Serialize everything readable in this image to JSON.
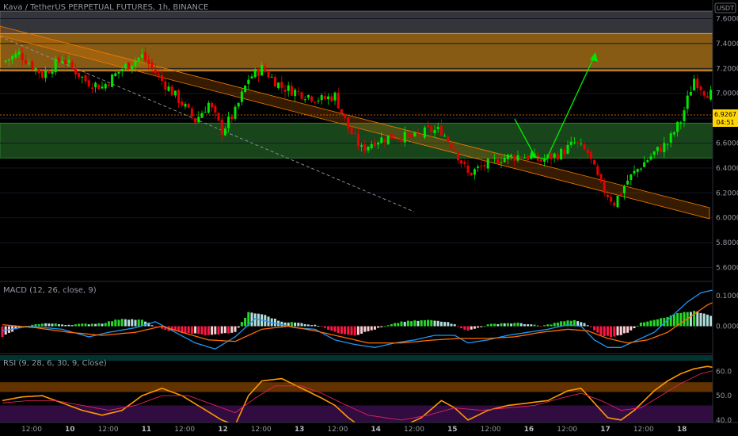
{
  "header": {
    "title": "Kava / TetherUS PERPETUAL FUTURES, 1h, BINANCE",
    "currency": "USDT"
  },
  "price_tag": {
    "price": "6.9267",
    "countdown": "04:51"
  },
  "chart_data": [
    {
      "type": "candlestick",
      "title": "Kava / TetherUS PERPETUAL FUTURES, 1h, BINANCE",
      "y_ticks": [
        "7.6000",
        "7.4000",
        "7.2000",
        "7.0000",
        "6.8000",
        "6.6000",
        "6.4000",
        "6.2000",
        "6.0000",
        "5.8000",
        "5.6000"
      ],
      "ylim": [
        5.52,
        7.75
      ],
      "x_ticks": [
        "12:00",
        "10",
        "12:00",
        "11",
        "12:00",
        "12",
        "12:00",
        "13",
        "12:00",
        "14",
        "12:00",
        "15",
        "12:00",
        "16",
        "12:00",
        "17",
        "12:00",
        "18"
      ],
      "last_price": 6.9267,
      "colors": {
        "up": "#26a69a",
        "down": "#ef5350",
        "up_bright": "#00e600",
        "down_bright": "#e60000"
      },
      "close_path": [
        [
          0,
          7.25
        ],
        [
          5,
          7.32
        ],
        [
          12,
          7.15
        ],
        [
          18,
          7.28
        ],
        [
          25,
          7.1
        ],
        [
          30,
          7.05
        ],
        [
          36,
          7.2
        ],
        [
          42,
          7.3
        ],
        [
          48,
          7.1
        ],
        [
          54,
          6.92
        ],
        [
          58,
          6.78
        ],
        [
          62,
          6.92
        ],
        [
          66,
          6.7
        ],
        [
          70,
          6.85
        ],
        [
          74,
          7.12
        ],
        [
          78,
          7.2
        ],
        [
          84,
          7.05
        ],
        [
          90,
          7.0
        ],
        [
          96,
          6.95
        ],
        [
          100,
          6.98
        ],
        [
          104,
          6.72
        ],
        [
          108,
          6.55
        ],
        [
          112,
          6.62
        ],
        [
          118,
          6.66
        ],
        [
          124,
          6.64
        ],
        [
          128,
          6.7
        ],
        [
          132,
          6.7
        ],
        [
          136,
          6.55
        ],
        [
          140,
          6.35
        ],
        [
          145,
          6.42
        ],
        [
          150,
          6.48
        ],
        [
          156,
          6.5
        ],
        [
          162,
          6.46
        ],
        [
          168,
          6.52
        ],
        [
          172,
          6.6
        ],
        [
          176,
          6.52
        ],
        [
          180,
          6.25
        ],
        [
          184,
          6.12
        ],
        [
          188,
          6.3
        ],
        [
          192,
          6.42
        ],
        [
          196,
          6.52
        ],
        [
          200,
          6.6
        ],
        [
          204,
          6.78
        ],
        [
          206,
          6.95
        ],
        [
          208,
          7.12
        ],
        [
          211,
          7.02
        ],
        [
          214,
          6.98
        ],
        [
          217,
          6.95
        ],
        [
          219,
          6.92
        ]
      ],
      "zones": [
        {
          "name": "gray-zone",
          "y1": 7.48,
          "y2": 7.66,
          "color": "#5d606b"
        },
        {
          "name": "orange-zone",
          "y1": 7.18,
          "y2": 7.48,
          "color": "#f5a623"
        },
        {
          "name": "green-zone",
          "y1": 6.48,
          "y2": 6.76,
          "color": "#2e7d32"
        }
      ]
    },
    {
      "type": "macd",
      "title": "MACD (12, 26, close, 9)",
      "y_ticks": [
        "0.1000",
        "0.0000"
      ],
      "ylim": [
        -0.09,
        0.145
      ],
      "histogram_path": [
        [
          0,
          -0.035
        ],
        [
          5,
          -0.005
        ],
        [
          12,
          0.01
        ],
        [
          20,
          0.005
        ],
        [
          30,
          0.01
        ],
        [
          36,
          0.025
        ],
        [
          42,
          0.02
        ],
        [
          48,
          -0.01
        ],
        [
          54,
          -0.02
        ],
        [
          62,
          -0.03
        ],
        [
          70,
          -0.02
        ],
        [
          74,
          0.045
        ],
        [
          78,
          0.04
        ],
        [
          84,
          0.015
        ],
        [
          90,
          0.01
        ],
        [
          96,
          0.0
        ],
        [
          100,
          -0.02
        ],
        [
          106,
          -0.03
        ],
        [
          112,
          -0.01
        ],
        [
          120,
          0.015
        ],
        [
          128,
          0.02
        ],
        [
          134,
          0.015
        ],
        [
          140,
          -0.015
        ],
        [
          146,
          0.005
        ],
        [
          150,
          0.01
        ],
        [
          156,
          0.01
        ],
        [
          162,
          0.0
        ],
        [
          168,
          0.015
        ],
        [
          172,
          0.02
        ],
        [
          176,
          0.005
        ],
        [
          180,
          -0.03
        ],
        [
          184,
          -0.035
        ],
        [
          188,
          -0.02
        ],
        [
          192,
          0.01
        ],
        [
          196,
          0.02
        ],
        [
          200,
          0.03
        ],
        [
          204,
          0.045
        ],
        [
          208,
          0.05
        ],
        [
          212,
          0.04
        ],
        [
          216,
          0.015
        ],
        [
          219,
          0.005
        ]
      ],
      "macd_path": [
        [
          0,
          -0.015
        ],
        [
          8,
          0.0
        ],
        [
          18,
          -0.01
        ],
        [
          26,
          -0.035
        ],
        [
          32,
          -0.02
        ],
        [
          40,
          -0.005
        ],
        [
          46,
          0.015
        ],
        [
          52,
          -0.02
        ],
        [
          58,
          -0.055
        ],
        [
          64,
          -0.075
        ],
        [
          70,
          -0.035
        ],
        [
          76,
          0.025
        ],
        [
          82,
          0.01
        ],
        [
          88,
          -0.005
        ],
        [
          94,
          -0.01
        ],
        [
          100,
          -0.045
        ],
        [
          106,
          -0.06
        ],
        [
          112,
          -0.07
        ],
        [
          118,
          -0.055
        ],
        [
          124,
          -0.045
        ],
        [
          130,
          -0.03
        ],
        [
          136,
          -0.03
        ],
        [
          140,
          -0.055
        ],
        [
          146,
          -0.045
        ],
        [
          152,
          -0.03
        ],
        [
          158,
          -0.02
        ],
        [
          164,
          -0.01
        ],
        [
          170,
          0.005
        ],
        [
          174,
          0.0
        ],
        [
          178,
          -0.045
        ],
        [
          182,
          -0.07
        ],
        [
          186,
          -0.07
        ],
        [
          190,
          -0.05
        ],
        [
          196,
          -0.02
        ],
        [
          202,
          0.04
        ],
        [
          206,
          0.08
        ],
        [
          210,
          0.11
        ],
        [
          214,
          0.12
        ],
        [
          217,
          0.118
        ],
        [
          219,
          0.112
        ]
      ],
      "signal_path": [
        [
          0,
          0.005
        ],
        [
          10,
          -0.005
        ],
        [
          20,
          -0.02
        ],
        [
          30,
          -0.03
        ],
        [
          40,
          -0.02
        ],
        [
          48,
          0.0
        ],
        [
          54,
          -0.02
        ],
        [
          62,
          -0.045
        ],
        [
          70,
          -0.05
        ],
        [
          78,
          -0.01
        ],
        [
          86,
          0.0
        ],
        [
          94,
          -0.015
        ],
        [
          102,
          -0.035
        ],
        [
          110,
          -0.055
        ],
        [
          120,
          -0.055
        ],
        [
          130,
          -0.045
        ],
        [
          138,
          -0.04
        ],
        [
          146,
          -0.04
        ],
        [
          154,
          -0.035
        ],
        [
          162,
          -0.02
        ],
        [
          170,
          -0.01
        ],
        [
          176,
          -0.015
        ],
        [
          182,
          -0.04
        ],
        [
          188,
          -0.055
        ],
        [
          194,
          -0.045
        ],
        [
          200,
          -0.02
        ],
        [
          206,
          0.025
        ],
        [
          212,
          0.07
        ],
        [
          216,
          0.09
        ],
        [
          219,
          0.1
        ]
      ]
    },
    {
      "type": "rsi",
      "title": "RSI (9, 28, 6, 30, 9, Close)",
      "y_ticks": [
        "60.0",
        "50.0",
        "40.0"
      ],
      "ylim": [
        39,
        64
      ],
      "bands": [
        {
          "name": "rsi-upper-band",
          "y1": 51.5,
          "y2": 55.5,
          "color": "#f57c00"
        },
        {
          "name": "rsi-lower-band",
          "y1": 39,
          "y2": 46,
          "color": "#7b1fa2"
        }
      ],
      "rsi_path": [
        [
          0,
          48
        ],
        [
          6,
          49.5
        ],
        [
          12,
          50
        ],
        [
          18,
          47
        ],
        [
          24,
          44
        ],
        [
          30,
          42
        ],
        [
          36,
          44
        ],
        [
          42,
          50
        ],
        [
          48,
          53
        ],
        [
          54,
          50
        ],
        [
          60,
          45
        ],
        [
          66,
          40
        ],
        [
          70,
          38
        ],
        [
          74,
          50
        ],
        [
          78,
          56
        ],
        [
          84,
          57
        ],
        [
          90,
          53
        ],
        [
          96,
          49
        ],
        [
          100,
          46
        ],
        [
          104,
          41
        ],
        [
          108,
          37
        ],
        [
          118,
          36
        ],
        [
          126,
          41
        ],
        [
          132,
          48
        ],
        [
          136,
          45
        ],
        [
          140,
          40
        ],
        [
          146,
          44
        ],
        [
          152,
          46
        ],
        [
          158,
          47
        ],
        [
          164,
          48
        ],
        [
          170,
          52
        ],
        [
          174,
          53
        ],
        [
          178,
          47
        ],
        [
          182,
          41
        ],
        [
          186,
          40
        ],
        [
          190,
          44
        ],
        [
          196,
          52
        ],
        [
          200,
          56
        ],
        [
          204,
          59
        ],
        [
          208,
          61
        ],
        [
          212,
          62
        ],
        [
          216,
          61
        ],
        [
          219,
          60
        ]
      ],
      "signal_path": [
        [
          0,
          47
        ],
        [
          8,
          48
        ],
        [
          16,
          48
        ],
        [
          24,
          46
        ],
        [
          32,
          44
        ],
        [
          40,
          46
        ],
        [
          48,
          50
        ],
        [
          56,
          50
        ],
        [
          62,
          47
        ],
        [
          70,
          43
        ],
        [
          76,
          49
        ],
        [
          82,
          54
        ],
        [
          90,
          54
        ],
        [
          96,
          51
        ],
        [
          102,
          47
        ],
        [
          110,
          42
        ],
        [
          120,
          40
        ],
        [
          128,
          42
        ],
        [
          136,
          45
        ],
        [
          144,
          44
        ],
        [
          152,
          45
        ],
        [
          160,
          46
        ],
        [
          168,
          49
        ],
        [
          174,
          51
        ],
        [
          180,
          48
        ],
        [
          186,
          44
        ],
        [
          192,
          45
        ],
        [
          198,
          50
        ],
        [
          204,
          55
        ],
        [
          210,
          59
        ],
        [
          216,
          61
        ],
        [
          219,
          61
        ]
      ]
    }
  ]
}
